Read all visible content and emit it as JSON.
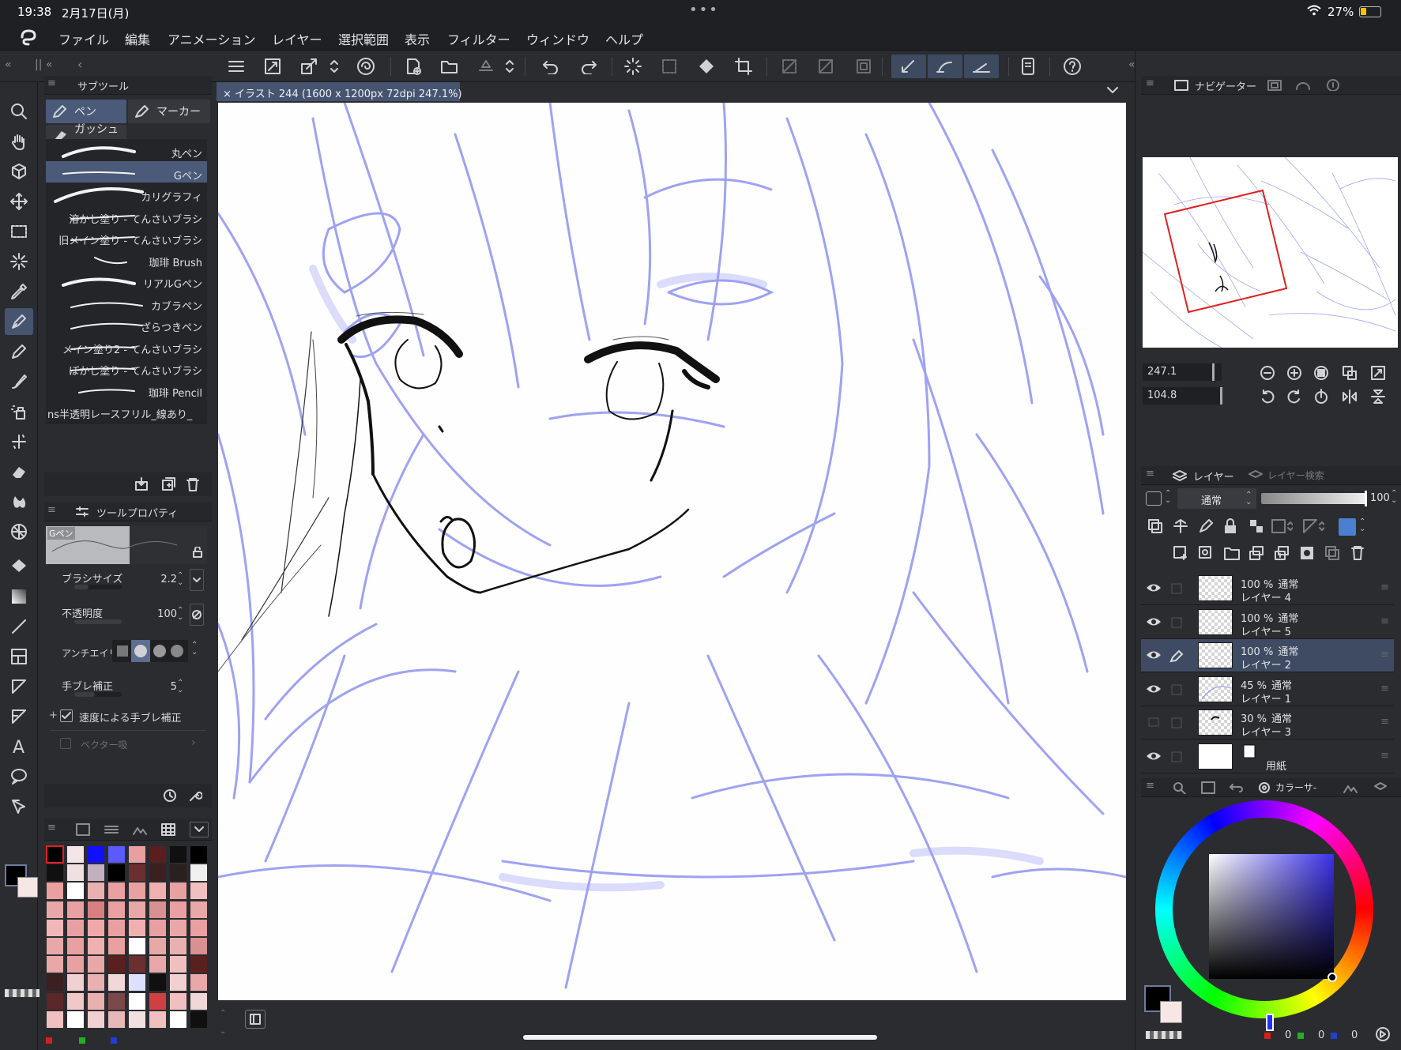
{
  "status": {
    "time": "19:38",
    "date": "2月17日(月)",
    "battery": "27%"
  },
  "menu": [
    "ファイル",
    "編集",
    "アニメーション",
    "レイヤー",
    "選択範囲",
    "表示",
    "フィルター",
    "ウィンドウ",
    "ヘルプ"
  ],
  "subtool": {
    "tab": "サブツール",
    "groups": [
      "ペン",
      "マーカー",
      "ガッシュな"
    ],
    "brushes": [
      "丸ペン",
      "Gペン",
      "カリグラフィ",
      "溶かし塗り - てんさいブラシ",
      "旧メイン塗り - てんさいブラシ",
      "珈琲 Brush",
      "リアルGペン",
      "カブラペン",
      "ざらつきペン",
      "メイン塗り2 - てんさいブラシ",
      "ぼかし塗り - てんさいブラシ",
      "珈琲 Pencil",
      "ns半透明レースフリル_線あり_"
    ],
    "active_brush": "Gペン"
  },
  "toolprop": {
    "tab": "ツールプロパティ",
    "preview_label": "Gペン",
    "brush_size_label": "ブラシサイズ",
    "brush_size": "2.2",
    "opacity_label": "不透明度",
    "opacity": "100",
    "antialias_label": "アンチエイリ",
    "stabilization_label": "手ブレ補正",
    "stabilization": "5",
    "speed_stab_label": "速度による手ブレ補正",
    "vector_label": "ベクター吸"
  },
  "document": {
    "tab_title": "イラスト 244 (1600 x 1200px 72dpi 247.1%)"
  },
  "navigator": {
    "tab": "ナビゲーター",
    "zoom": "247.1",
    "rotation": "104.8"
  },
  "layers": {
    "tab": "レイヤー",
    "search_tab": "レイヤー検索",
    "blend_mode": "通常",
    "opacity": "100",
    "items": [
      {
        "percent": "100 %",
        "mode": "通常",
        "name": "レイヤー 4",
        "visible": true,
        "active": false
      },
      {
        "percent": "100 %",
        "mode": "通常",
        "name": "レイヤー 5",
        "visible": true,
        "active": false
      },
      {
        "percent": "100 %",
        "mode": "通常",
        "name": "レイヤー 2",
        "visible": true,
        "active": true
      },
      {
        "percent": "45 %",
        "mode": "通常",
        "name": "レイヤー 1",
        "visible": true,
        "active": false
      },
      {
        "percent": "30 %",
        "mode": "通常",
        "name": "レイヤー 3",
        "visible": false,
        "active": false
      },
      {
        "percent": "",
        "mode": "",
        "name": "用紙",
        "visible": true,
        "active": false
      }
    ]
  },
  "color": {
    "tab": "カラーサ-",
    "r": "0",
    "g": "0",
    "b": "0",
    "main": "#000000",
    "sub": "#f6e6e4"
  },
  "colors": {
    "accent": "#465470",
    "sketch": "#7b7ff0",
    "canvas": "#ffffff",
    "selection": "#e02020"
  }
}
